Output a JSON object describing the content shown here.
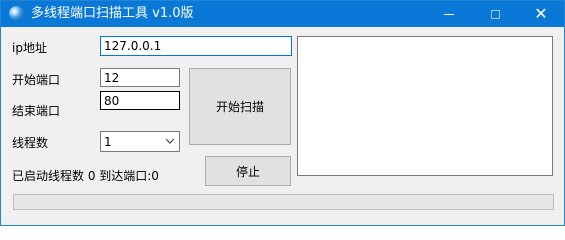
{
  "window": {
    "title": "多线程端口扫描工具 v1.0版"
  },
  "controls": {
    "close_symbol": "✕"
  },
  "form": {
    "ip_label": "ip地址",
    "ip_value": "127.0.0.1",
    "start_port_label": "开始端口",
    "start_port_value": "12",
    "end_port_label": "结束端口",
    "end_port_value": "80",
    "threads_label": "线程数",
    "threads_value": "1"
  },
  "buttons": {
    "start_scan": "开始扫描",
    "stop": "停止"
  },
  "status": {
    "text": "已启动线程数 0 到达端口:0"
  },
  "progress": {
    "value": 0
  },
  "colors": {
    "titlebar": "#0a78d7",
    "accent": "#0078d7"
  }
}
